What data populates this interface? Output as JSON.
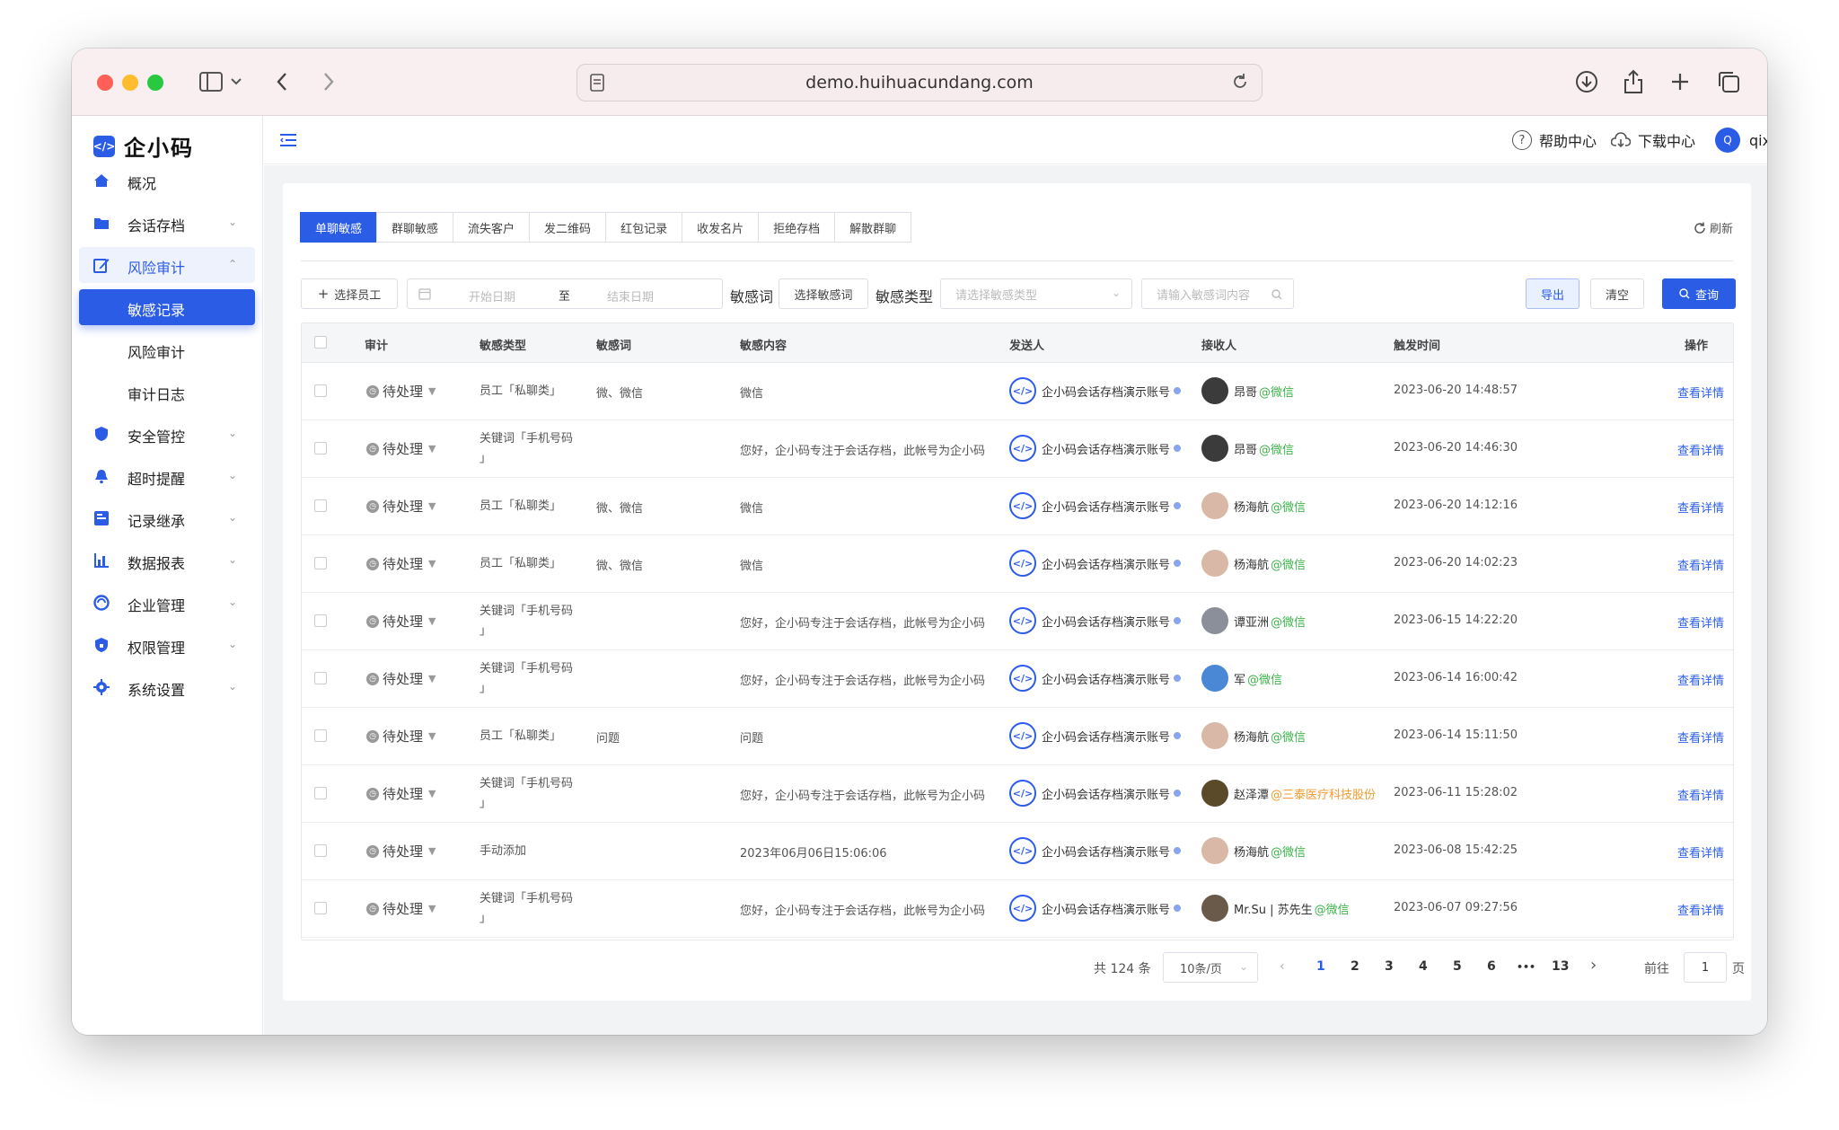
{
  "browser": {
    "url": "demo.huihuacundang.com"
  },
  "brand": {
    "logo_glyph": "</>",
    "name": "企小码",
    "accent": "#2b5ce6"
  },
  "sidebar": {
    "items": [
      {
        "label": "概况"
      },
      {
        "label": "会话存档"
      },
      {
        "label": "风险审计"
      },
      {
        "label": "敏感记录"
      },
      {
        "label": "风险审计"
      },
      {
        "label": "审计日志"
      },
      {
        "label": "安全管控"
      },
      {
        "label": "超时提醒"
      },
      {
        "label": "记录继承"
      },
      {
        "label": "数据报表"
      },
      {
        "label": "企业管理"
      },
      {
        "label": "权限管理"
      },
      {
        "label": "系统设置"
      }
    ]
  },
  "header": {
    "help": "帮助中心",
    "download": "下载中心",
    "avatar_letter": "Q",
    "user": "qixiaoma"
  },
  "tabs": [
    "单聊敏感",
    "群聊敏感",
    "流失客户",
    "发二维码",
    "红包记录",
    "收发名片",
    "拒绝存档",
    "解散群聊"
  ],
  "refresh_label": "刷新",
  "filters": {
    "select_staff": "选择员工",
    "start_date": "开始日期",
    "to": "至",
    "end_date": "结束日期",
    "sensitive_word_label": "敏感词",
    "select_sensitive_word": "选择敏感词",
    "sensitive_type_label": "敏感类型",
    "type_placeholder": "请选择敏感类型",
    "content_placeholder": "请输入敏感词内容",
    "export": "导出",
    "clear": "清空",
    "query": "查询"
  },
  "table": {
    "columns": [
      "审计",
      "敏感类型",
      "敏感词",
      "敏感内容",
      "发送人",
      "接收人",
      "触发时间",
      "操作"
    ],
    "rows": [
      {
        "audit": "待处理",
        "type1": "员工「私聊类」",
        "type2": "",
        "word": "微、微信",
        "content": "微信",
        "sender": "企小码会话存档演示账号",
        "receiver": "昂哥",
        "tag": "@微信",
        "time": "2023-06-20 14:48:57",
        "action": "查看详情"
      },
      {
        "audit": "待处理",
        "type1": "关键词「手机号码",
        "type2": "」",
        "word": "",
        "content": "您好，企小码专注于会话存档，此帐号为企小码",
        "sender": "企小码会话存档演示账号",
        "receiver": "昂哥",
        "tag": "@微信",
        "time": "2023-06-20 14:46:30",
        "action": "查看详情"
      },
      {
        "audit": "待处理",
        "type1": "员工「私聊类」",
        "type2": "",
        "word": "微、微信",
        "content": "微信",
        "sender": "企小码会话存档演示账号",
        "receiver": "杨海航",
        "tag": "@微信",
        "time": "2023-06-20 14:12:16",
        "action": "查看详情"
      },
      {
        "audit": "待处理",
        "type1": "员工「私聊类」",
        "type2": "",
        "word": "微、微信",
        "content": "微信",
        "sender": "企小码会话存档演示账号",
        "receiver": "杨海航",
        "tag": "@微信",
        "time": "2023-06-20 14:02:23",
        "action": "查看详情"
      },
      {
        "audit": "待处理",
        "type1": "关键词「手机号码",
        "type2": "」",
        "word": "",
        "content": "您好，企小码专注于会话存档，此帐号为企小码",
        "sender": "企小码会话存档演示账号",
        "receiver": "谭亚洲",
        "tag": "@微信",
        "time": "2023-06-15 14:22:20",
        "action": "查看详情"
      },
      {
        "audit": "待处理",
        "type1": "关键词「手机号码",
        "type2": "」",
        "word": "",
        "content": "您好，企小码专注于会话存档，此帐号为企小码",
        "sender": "企小码会话存档演示账号",
        "receiver": "军",
        "tag": "@微信",
        "time": "2023-06-14 16:00:42",
        "action": "查看详情"
      },
      {
        "audit": "待处理",
        "type1": "员工「私聊类」",
        "type2": "",
        "word": "问题",
        "content": "问题",
        "sender": "企小码会话存档演示账号",
        "receiver": "杨海航",
        "tag": "@微信",
        "time": "2023-06-14 15:11:50",
        "action": "查看详情"
      },
      {
        "audit": "待处理",
        "type1": "关键词「手机号码",
        "type2": "」",
        "word": "",
        "content": "您好，企小码专注于会话存档，此帐号为企小码",
        "sender": "企小码会话存档演示账号",
        "receiver": "赵泽潭",
        "tag": "@三泰医疗科技股份",
        "time": "2023-06-11 15:28:02",
        "action": "查看详情"
      },
      {
        "audit": "待处理",
        "type1": "手动添加",
        "type2": "",
        "word": "",
        "content": "2023年06月06日15:06:06",
        "sender": "企小码会话存档演示账号",
        "receiver": "杨海航",
        "tag": "@微信",
        "time": "2023-06-08 15:42:25",
        "action": "查看详情"
      },
      {
        "audit": "待处理",
        "type1": "关键词「手机号码",
        "type2": "」",
        "word": "",
        "content": "您好，企小码专注于会话存档，此帐号为企小码",
        "sender": "企小码会话存档演示账号",
        "receiver": "Mr.Su | 苏先生",
        "tag": "@微信",
        "time": "2023-06-07 09:27:56",
        "action": "查看详情"
      }
    ]
  },
  "pagination": {
    "total": "共 124 条",
    "page_size": "10条/页",
    "pages": [
      "1",
      "2",
      "3",
      "4",
      "5",
      "6",
      "•••",
      "13"
    ],
    "current": "1",
    "goto_prefix": "前往",
    "goto_value": "1",
    "goto_suffix": "页"
  }
}
